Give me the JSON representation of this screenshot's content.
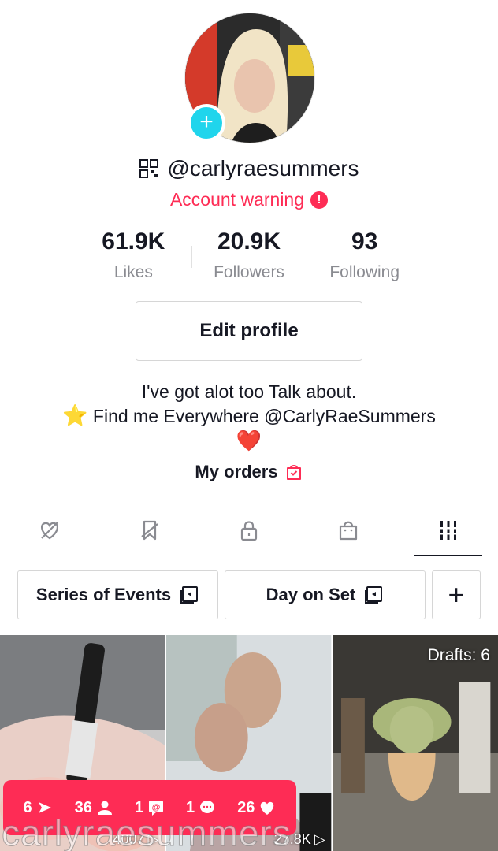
{
  "profile": {
    "username": "@carlyraesummers",
    "account_warning": "Account warning",
    "avatar_add_symbol": "+"
  },
  "stats": [
    {
      "value": "93",
      "label": "Following"
    },
    {
      "value": "20.9K",
      "label": "Followers"
    },
    {
      "value": "61.9K",
      "label": "Likes"
    }
  ],
  "edit_profile_label": "Edit profile",
  "bio": {
    "line1": "I've got alot too Talk about.",
    "line2": "Find me Everywhere @CarlyRaeSummers",
    "star": "⭐",
    "heart": "❤️"
  },
  "my_orders_label": "My orders",
  "tabs": [
    {
      "icon": "grid-icon",
      "active": true
    },
    {
      "icon": "shop-bag-icon",
      "active": false
    },
    {
      "icon": "lock-icon",
      "active": false
    },
    {
      "icon": "hidden-bookmark-icon",
      "active": false
    },
    {
      "icon": "hidden-liked-icon",
      "active": false
    }
  ],
  "playlists": {
    "add_symbol": "+",
    "items": [
      {
        "label": "Day on Set"
      },
      {
        "label": "Series of Events"
      }
    ]
  },
  "grid": {
    "drafts_label": "Drafts: 6",
    "video2_views": "27.8K",
    "video3_views": "4007"
  },
  "notification": {
    "likes": "26",
    "comments": "1",
    "mentions": "1",
    "followers": "36",
    "shares": "6"
  },
  "watermark": "carlyraesummers",
  "colors": {
    "accent": "#fe2c55",
    "avatar_add": "#20d5ec",
    "text": "#161823",
    "muted": "#8a8b91"
  }
}
